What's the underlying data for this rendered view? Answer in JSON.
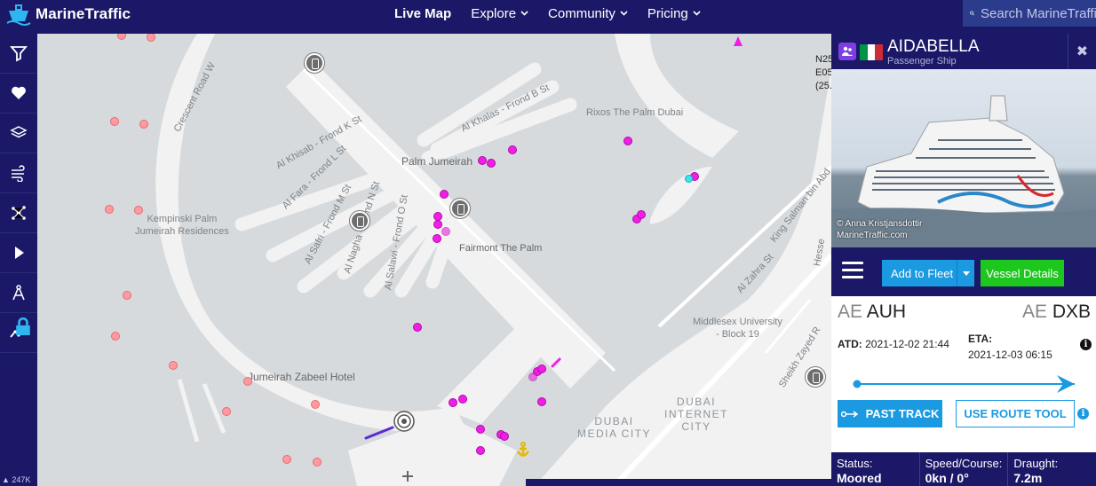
{
  "brand": {
    "name": "MarineTraffic"
  },
  "nav": {
    "items": [
      {
        "label": "Live Map",
        "active": true,
        "dropdown": false
      },
      {
        "label": "Explore",
        "dropdown": true
      },
      {
        "label": "Community",
        "dropdown": true
      },
      {
        "label": "Pricing",
        "dropdown": true
      }
    ]
  },
  "search": {
    "placeholder": "Search MarineTraffic"
  },
  "sidebar": {
    "tools": [
      "filter-icon",
      "heart-icon",
      "layers-icon",
      "wind-icon",
      "network-icon",
      "play-icon",
      "measure-icon",
      "analytics-icon"
    ],
    "scale_label": "247K"
  },
  "map": {
    "coordinates": [
      "N25",
      "E05",
      "(25."
    ],
    "labels": {
      "frond_b": "Al Khalas - Frond B St",
      "frond_k": "Al Khisab - Frond K St",
      "frond_l": "Al Fara - Frond L St",
      "frond_m": "Al Safri - Frond M St",
      "frond_n": "Al Nagha - Frond N St",
      "frond_o": "Al Salawi - Frond O St",
      "crescent": "Crescent Road W",
      "rixos": "Rixos The Palm Dubai",
      "palm": "Palm Jumeirah",
      "kempinski": "Kempinski Palm\nJumeirah Residences",
      "fairmont": "Fairmont The Palm",
      "king_salman": "King Salman bin Abd",
      "zahra": "Al Zahra St",
      "middlesex": "Middlesex University\n- Block 19",
      "zabeel": "Jumeirah Zabeel Hotel",
      "internet_city": "DUBAI\nINTERNET\nCITY",
      "media_city": "DUBAI\nMEDIA CITY",
      "zayed": "Sheikh Zayed R",
      "hessa": "Hesse"
    }
  },
  "vessel": {
    "name": "AIDABELLA",
    "type": "Passenger Ship",
    "photo_credit": "© Anna Kristjansdottir\nMarineTraffic.com",
    "flag_colors": [
      "#009246",
      "#ffffff",
      "#ce2b37"
    ],
    "actions": {
      "add_to_fleet": "Add to Fleet",
      "vessel_details": "Vessel Details"
    },
    "route": {
      "from_country": "AE",
      "from_port": "AUH",
      "to_country": "AE",
      "to_port": "DXB",
      "atd_label": "ATD:",
      "atd": "2021-12-02 21:44",
      "eta_label": "ETA:",
      "eta": "2021-12-03 06:15",
      "progress": 1.0
    },
    "buttons": {
      "past_track": "PAST TRACK",
      "route_tool": "USE ROUTE TOOL"
    },
    "stats": [
      {
        "label": "Status:",
        "value": "Moored"
      },
      {
        "label": "Speed/Course:",
        "value": "0kn / 0°"
      },
      {
        "label": "Draught:",
        "value": "7.2m"
      }
    ]
  },
  "colors": {
    "navy": "#1c1868",
    "accent_blue": "#1b9ae2",
    "green": "#1ec71e",
    "magenta": "#f01ee6",
    "pink": "#ff9aa0"
  }
}
